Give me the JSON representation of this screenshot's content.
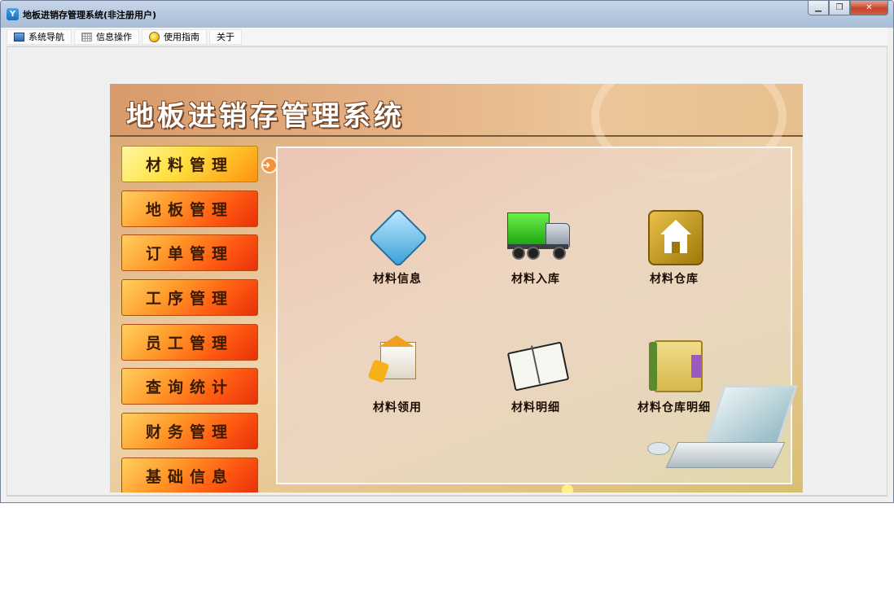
{
  "window": {
    "title": "地板进销存管理系统(非注册用户)",
    "app_icon": "app-logo-icon",
    "buttons": {
      "minimize": "minimize-icon",
      "restore": "restore-icon",
      "close": "close-icon"
    }
  },
  "menu": {
    "items": [
      {
        "label": "系统导航",
        "icon": "monitor-icon"
      },
      {
        "label": "信息操作",
        "icon": "grid-icon"
      },
      {
        "label": "使用指南",
        "icon": "guide-icon"
      },
      {
        "label": "关于",
        "icon": ""
      }
    ]
  },
  "banner": {
    "title": "地板进销存管理系统"
  },
  "sidebar": {
    "items": [
      {
        "label": "材料管理",
        "active": true
      },
      {
        "label": "地板管理"
      },
      {
        "label": "订单管理"
      },
      {
        "label": "工序管理"
      },
      {
        "label": "员工管理"
      },
      {
        "label": "查询统计"
      },
      {
        "label": "财务管理"
      },
      {
        "label": "基础信息"
      }
    ]
  },
  "content": {
    "tiles": [
      {
        "label": "材料信息",
        "icon": "book-icon"
      },
      {
        "label": "材料入库",
        "icon": "truck-icon"
      },
      {
        "label": "材料仓库",
        "icon": "warehouse-icon"
      },
      {
        "label": "材料领用",
        "icon": "building-icon"
      },
      {
        "label": "材料明细",
        "icon": "notebook-icon"
      },
      {
        "label": "材料仓库明细",
        "icon": "folder-icon"
      }
    ]
  },
  "colors": {
    "accent": "#ff6a12",
    "active": "#ffe040",
    "titlebar": "#b7c9e0"
  }
}
